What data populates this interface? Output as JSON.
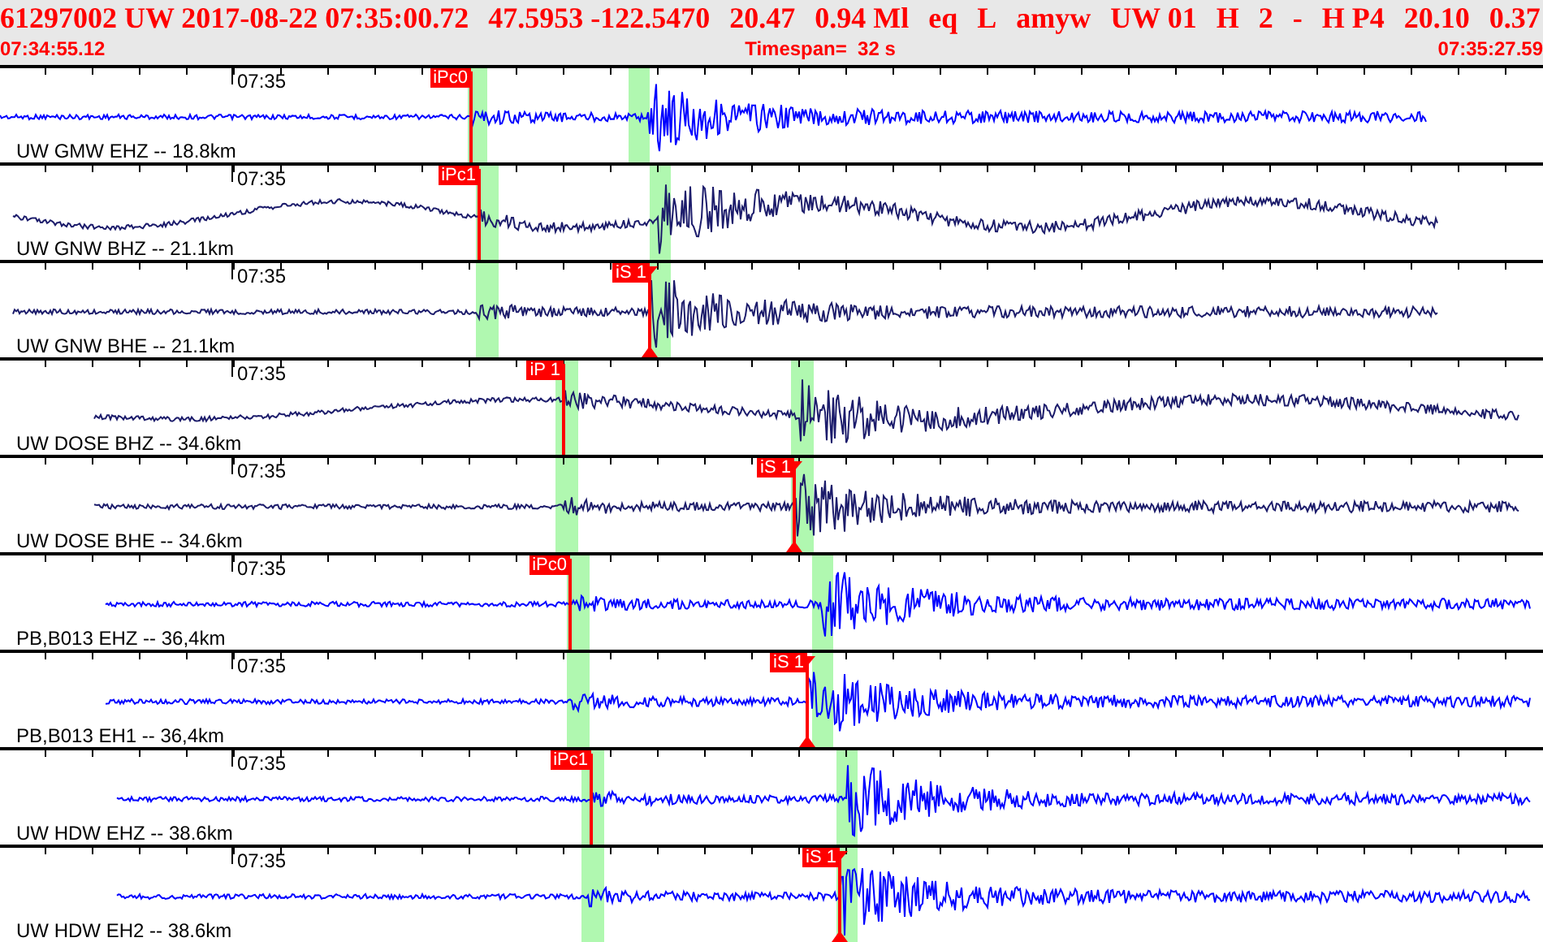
{
  "header": {
    "event": [
      "61297002 UW 2017-08-22 07:35:00.72",
      "47.5953 -122.5470",
      "20.47",
      "0.94 Ml",
      "eq",
      "L",
      "amyw",
      "UW 01",
      "H",
      "2",
      "-",
      "H P4",
      "20.10",
      "0.37"
    ],
    "start_time": "07:34:55.12",
    "timespan": "Timespan=  32 s",
    "end_time": "07:35:27.59"
  },
  "traces": [
    {
      "label": "UW GMW EHZ -- 18.8km",
      "time": "07:35",
      "pick": "iPc0",
      "kind": "p"
    },
    {
      "label": "UW GNW BHZ -- 21.1km",
      "time": "07:35",
      "pick": "iPc1",
      "kind": "p"
    },
    {
      "label": "UW GNW BHE -- 21.1km",
      "time": "07:35",
      "pick": "iS 1",
      "kind": "s"
    },
    {
      "label": "UW DOSE BHZ -- 34.6km",
      "time": "07:35",
      "pick": "iP 1",
      "kind": "p"
    },
    {
      "label": "UW DOSE BHE -- 34.6km",
      "time": "07:35",
      "pick": "iS 1",
      "kind": "s"
    },
    {
      "label": "PB,B013 EHZ -- 36,4km",
      "time": "07:35",
      "pick": "iPc0",
      "kind": "p"
    },
    {
      "label": "PB,B013 EH1 -- 36,4km",
      "time": "07:35",
      "pick": "iS 1",
      "kind": "s"
    },
    {
      "label": "UW HDW EHZ -- 38.6km",
      "time": "07:35",
      "pick": "iPc1",
      "kind": "p"
    },
    {
      "label": "UW HDW EH2 -- 38.6km",
      "time": "07:35",
      "pick": "iS 1",
      "kind": "s"
    }
  ]
}
